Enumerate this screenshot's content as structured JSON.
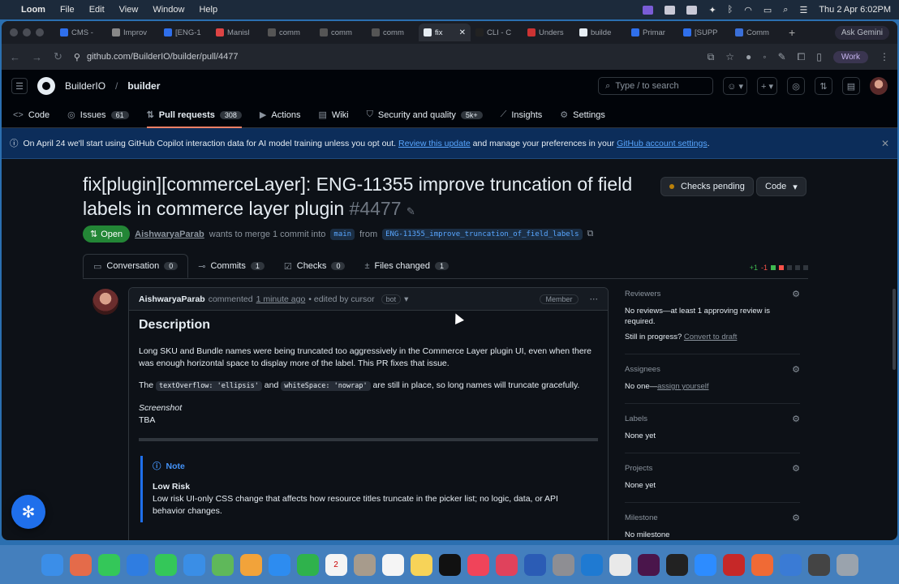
{
  "menubar": {
    "app": "Loom",
    "items": [
      "File",
      "Edit",
      "View",
      "Window",
      "Help"
    ],
    "datetime": "Thu 2 Apr  6:02PM"
  },
  "tabs": [
    {
      "label": "CMS -",
      "color": "#2f6feb"
    },
    {
      "label": "Improv",
      "color": "#888"
    },
    {
      "label": "[ENG-1",
      "color": "#2f6feb"
    },
    {
      "label": "Manisl",
      "color": "#d44"
    },
    {
      "label": "comm",
      "color": "#555"
    },
    {
      "label": "comm",
      "color": "#555"
    },
    {
      "label": "comm",
      "color": "#555"
    },
    {
      "label": "fix",
      "color": "#e6edf3"
    },
    {
      "label": "CLI - C",
      "color": "#222"
    },
    {
      "label": "Unders",
      "color": "#c33"
    },
    {
      "label": "builde",
      "color": "#e6edf3"
    },
    {
      "label": "Primar",
      "color": "#2f6feb"
    },
    {
      "label": "[SUPP",
      "color": "#2f6feb"
    },
    {
      "label": "Comm",
      "color": "#3a6fd8"
    }
  ],
  "active_tab_index": 7,
  "ask_gemini": "Ask Gemini",
  "url": "github.com/BuilderIO/builder/pull/4477",
  "work_profile": "Work",
  "github": {
    "org": "BuilderIO",
    "repo": "builder",
    "search_placeholder": "Type / to search",
    "search_key": "/",
    "nav": [
      {
        "label": "Code",
        "icon": "<>",
        "count": ""
      },
      {
        "label": "Issues",
        "icon": "◎",
        "count": "61"
      },
      {
        "label": "Pull requests",
        "icon": "⇅",
        "count": "308"
      },
      {
        "label": "Actions",
        "icon": "▶",
        "count": ""
      },
      {
        "label": "Wiki",
        "icon": "▤",
        "count": ""
      },
      {
        "label": "Security and quality",
        "icon": "⛉",
        "count": "5k+"
      },
      {
        "label": "Insights",
        "icon": "⟋",
        "count": ""
      },
      {
        "label": "Settings",
        "icon": "⚙",
        "count": ""
      }
    ]
  },
  "banner": {
    "text1": "On April 24 we'll start using GitHub Copilot interaction data for AI model training unless you opt out.",
    "link1": "Review this update",
    "text2": "and manage your preferences in your",
    "link2": "GitHub account settings",
    "text3": "."
  },
  "pr": {
    "title": "fix[plugin][commerceLayer]: ENG-11355 improve truncation of field labels in commerce layer plugin",
    "number": "#4477",
    "checks": "Checks pending",
    "code": "Code",
    "state": "Open",
    "author": "AishwaryaParab",
    "merge_text": "wants to merge 1 commit into",
    "base": "main",
    "from_text": "from",
    "head": "ENG-11355_improve_truncation_of_field_labels",
    "tabs": [
      {
        "label": "Conversation",
        "count": "0",
        "icon": "▭"
      },
      {
        "label": "Commits",
        "count": "1",
        "icon": "⊸"
      },
      {
        "label": "Checks",
        "count": "0",
        "icon": "☑"
      },
      {
        "label": "Files changed",
        "count": "1",
        "icon": "±"
      }
    ],
    "diff_add": "+1",
    "diff_del": "-1"
  },
  "comment": {
    "author": "AishwaryaParab",
    "action": "commented",
    "time": "1 minute ago",
    "edited": "• edited by cursor",
    "bot": "bot",
    "role": "Member",
    "heading": "Description",
    "p1": "Long SKU and Bundle names were being truncated too aggressively in the Commerce Layer plugin UI, even when there was enough horizontal space to display more of the label. This PR fixes that issue.",
    "p2_a": "The",
    "p2_code1": "textOverflow: 'ellipsis'",
    "p2_b": "and",
    "p2_code2": "whiteSpace: 'nowrap'",
    "p2_c": "are still in place, so long names will truncate gracefully.",
    "screenshot_label": "Screenshot",
    "screenshot_value": "TBA",
    "note_title": "Note",
    "risk_title": "Low Risk",
    "risk_text": "Low risk UI-only CSS change that affects how resource titles truncate in the picker list; no logic, data, or API behavior changes."
  },
  "sidebar": {
    "reviewers_label": "Reviewers",
    "reviewers_text": "No reviews—at least 1 approving review is required.",
    "progress_text": "Still in progress?",
    "progress_link": "Convert to draft",
    "assignees_label": "Assignees",
    "assignees_text": "No one—",
    "assignees_link": "assign yourself",
    "labels_label": "Labels",
    "labels_text": "None yet",
    "projects_label": "Projects",
    "projects_text": "None yet",
    "milestone_label": "Milestone",
    "milestone_text": "No milestone"
  },
  "dock": [
    {
      "name": "finder",
      "color": "#3b8ee8"
    },
    {
      "name": "launchpad",
      "color": "#e46b4a"
    },
    {
      "name": "phone",
      "color": "#34c759"
    },
    {
      "name": "safari",
      "color": "#2f7de1"
    },
    {
      "name": "messages",
      "color": "#34c759"
    },
    {
      "name": "mail",
      "color": "#3a8ee6"
    },
    {
      "name": "maps",
      "color": "#5fb85a"
    },
    {
      "name": "photos",
      "color": "#f2a33a"
    },
    {
      "name": "app-store",
      "color": "#2d8cf0"
    },
    {
      "name": "facetime",
      "color": "#2fb24c"
    },
    {
      "name": "calendar",
      "color": "#f4f4f4",
      "label": "2"
    },
    {
      "name": "contacts",
      "color": "#a79b8c"
    },
    {
      "name": "reminders",
      "color": "#f5f5f5"
    },
    {
      "name": "notes",
      "color": "#f7d358"
    },
    {
      "name": "tv",
      "color": "#111"
    },
    {
      "name": "music",
      "color": "#f0445a"
    },
    {
      "name": "rocket",
      "color": "#e0425c"
    },
    {
      "name": "word",
      "color": "#2b5cb5"
    },
    {
      "name": "settings",
      "color": "#8e8e93"
    },
    {
      "name": "vscode",
      "color": "#1f7ad2"
    },
    {
      "name": "chrome",
      "color": "#e9e9e9"
    },
    {
      "name": "slack",
      "color": "#4a154b"
    },
    {
      "name": "terminal",
      "color": "#222"
    },
    {
      "name": "zoom",
      "color": "#2d8cff"
    },
    {
      "name": "red-app",
      "color": "#c62828"
    },
    {
      "name": "pen-app",
      "color": "#f06a35"
    },
    {
      "name": "snowflake",
      "color": "#3a7bd5"
    },
    {
      "name": "downloads",
      "color": "#444"
    },
    {
      "name": "trash",
      "color": "#9aa3ad"
    }
  ]
}
